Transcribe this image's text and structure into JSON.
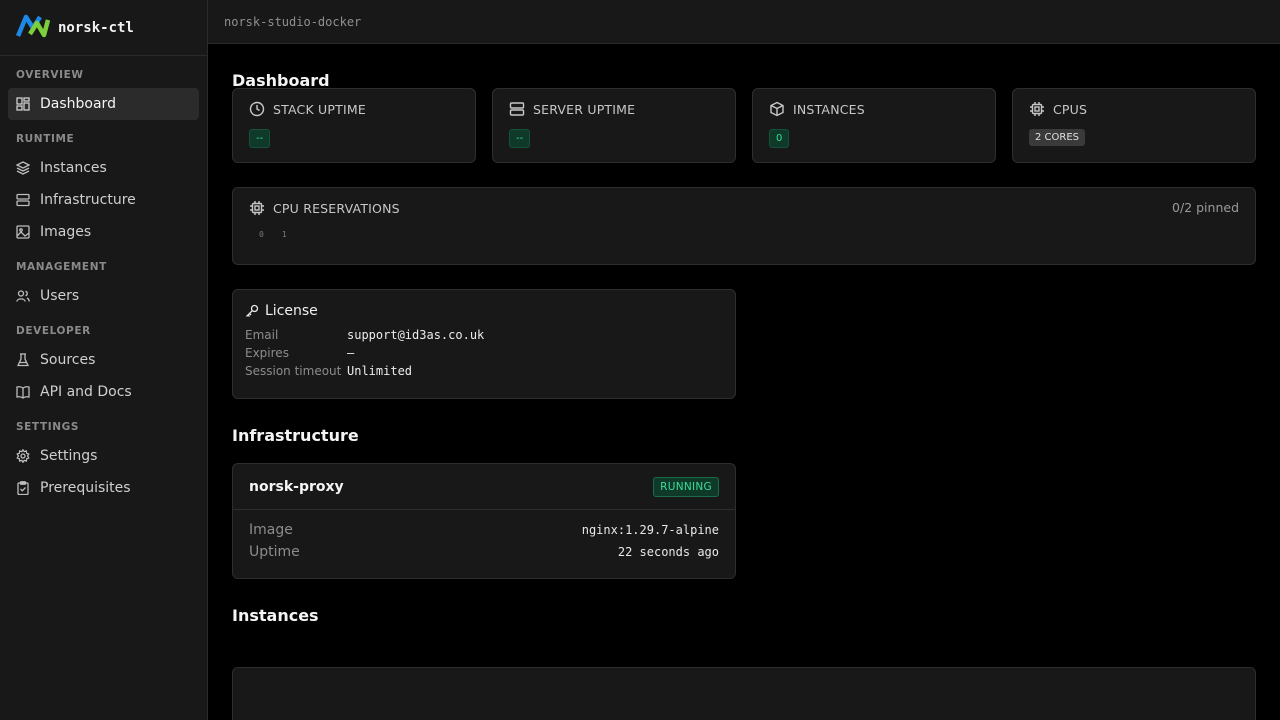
{
  "app": {
    "name": "norsk-ctl"
  },
  "topbar": {
    "title": "norsk-studio-docker"
  },
  "sidebar": {
    "sections": [
      {
        "heading": "OVERVIEW",
        "items": [
          {
            "label": "Dashboard",
            "icon": "dashboard-icon",
            "active": true
          }
        ]
      },
      {
        "heading": "RUNTIME",
        "items": [
          {
            "label": "Instances",
            "icon": "layers-icon"
          },
          {
            "label": "Infrastructure",
            "icon": "server-icon"
          },
          {
            "label": "Images",
            "icon": "image-icon"
          }
        ]
      },
      {
        "heading": "MANAGEMENT",
        "items": [
          {
            "label": "Users",
            "icon": "users-icon"
          }
        ]
      },
      {
        "heading": "DEVELOPER",
        "items": [
          {
            "label": "Sources",
            "icon": "flask-icon"
          },
          {
            "label": "API and Docs",
            "icon": "book-icon"
          }
        ]
      },
      {
        "heading": "SETTINGS",
        "items": [
          {
            "label": "Settings",
            "icon": "gear-icon"
          },
          {
            "label": "Prerequisites",
            "icon": "clipboard-icon"
          }
        ]
      }
    ]
  },
  "main": {
    "title": "Dashboard",
    "stats": [
      {
        "label": "STACK UPTIME",
        "value": "--",
        "icon": "clock-icon",
        "style": "green"
      },
      {
        "label": "SERVER UPTIME",
        "value": "--",
        "icon": "server-icon",
        "style": "green"
      },
      {
        "label": "INSTANCES",
        "value": "0",
        "icon": "cube-icon",
        "style": "green"
      },
      {
        "label": "CPUS",
        "value": "2 CORES",
        "icon": "cpu-icon",
        "style": "gray"
      }
    ],
    "cpu_reservations": {
      "label": "CPU RESERVATIONS",
      "pinned": "0/2 pinned",
      "cores": [
        "0",
        "1"
      ]
    },
    "license": {
      "title": "License",
      "rows": [
        {
          "key": "Email",
          "value": "support@id3as.co.uk"
        },
        {
          "key": "Expires",
          "value": "—"
        },
        {
          "key": "Session timeout",
          "value": "Unlimited"
        }
      ]
    },
    "infrastructure": {
      "title": "Infrastructure",
      "items": [
        {
          "name": "norsk-proxy",
          "status": "RUNNING",
          "image_label": "Image",
          "image": "nginx:1.29.7-alpine",
          "uptime_label": "Uptime",
          "uptime": "22 seconds ago"
        }
      ]
    },
    "instances": {
      "title": "Instances"
    }
  }
}
